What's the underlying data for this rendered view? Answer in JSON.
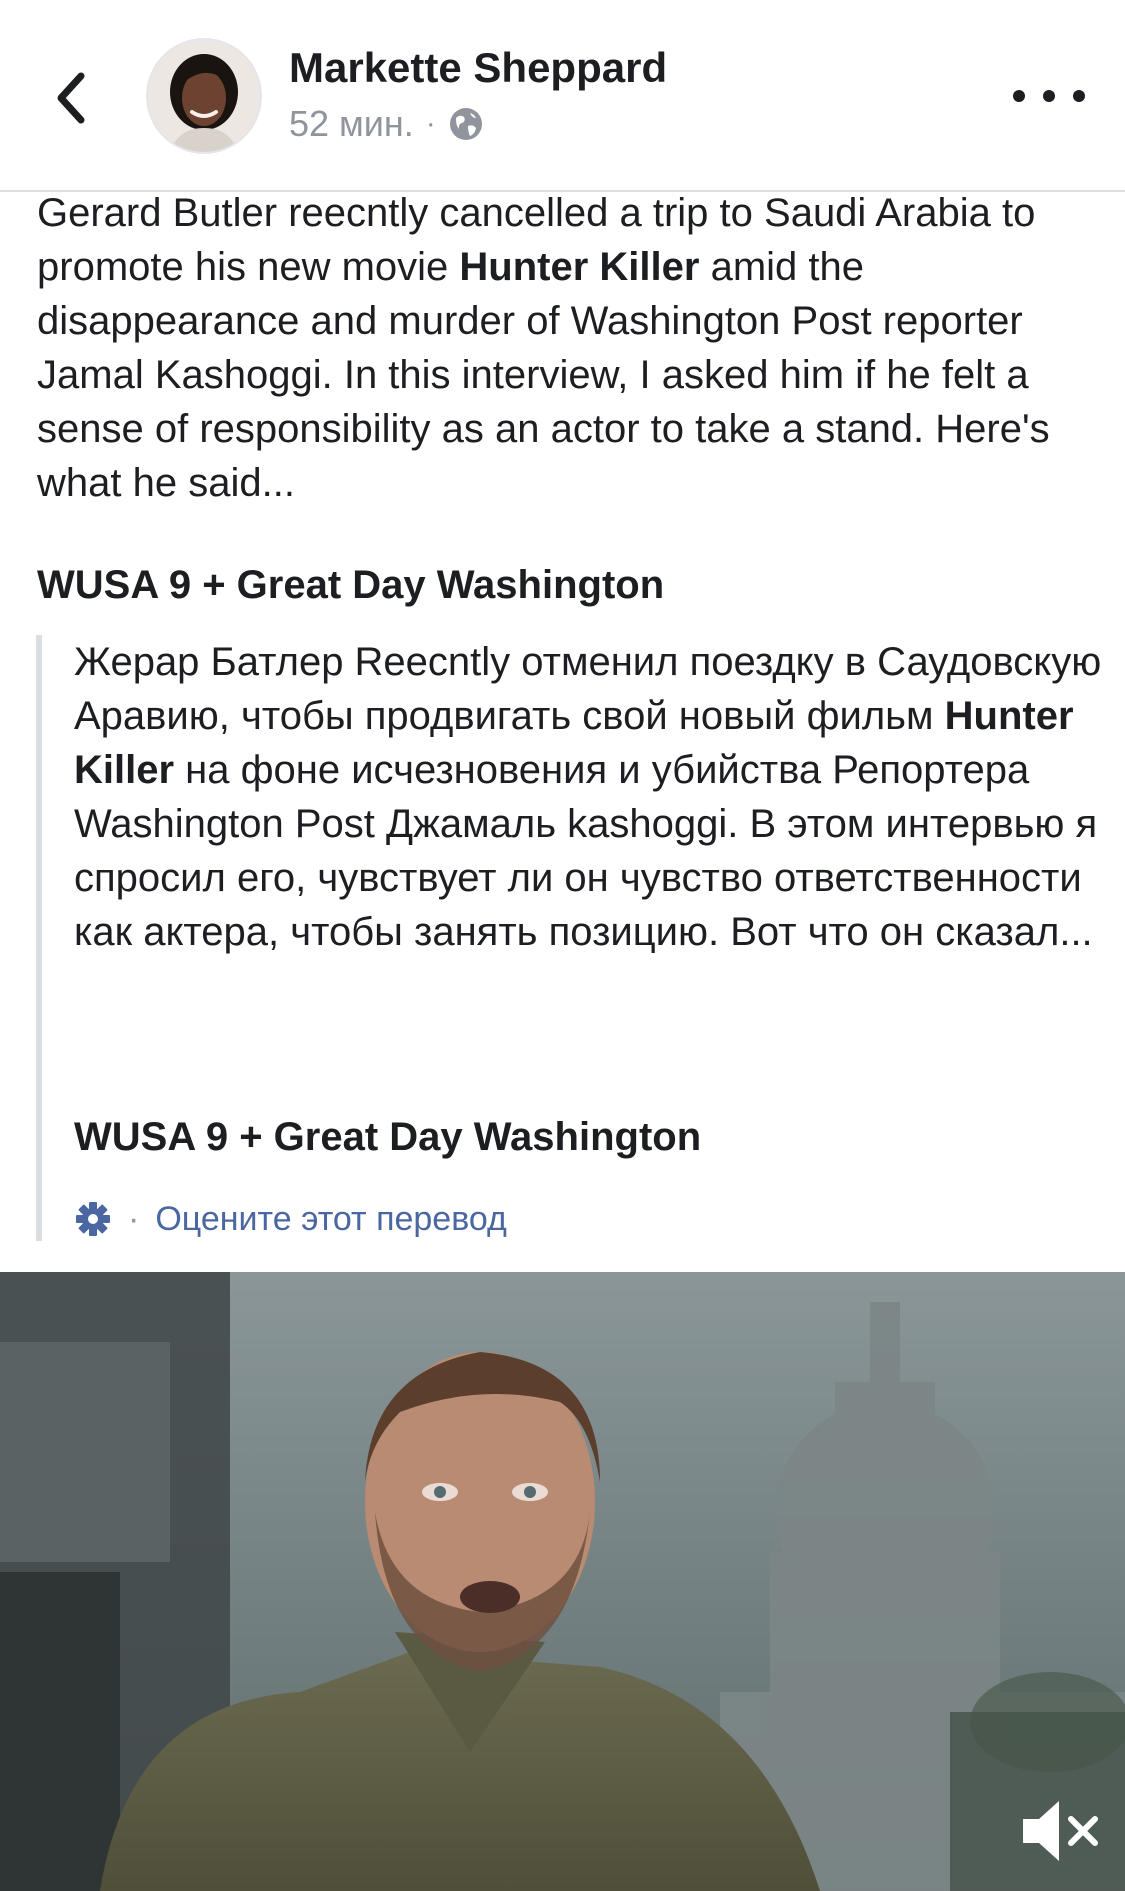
{
  "header": {
    "author_name": "Markette Sheppard",
    "time": "52 мин.",
    "separator": "·",
    "back_icon": "chevron-left-icon",
    "privacy_icon": "globe-icon",
    "more_icon": "more-horizontal-icon"
  },
  "post": {
    "text_part1": "Gerard Butler reecntly cancelled a trip to Saudi Arabia to promote his new movie ",
    "movie_title": "Hunter Killer",
    "text_part2": " amid the disappearance and murder of Washington Post reporter Jamal Kashoggi. In this interview, I asked him if he felt a sense of responsibility as an actor to take a stand. Here's what he said...",
    "source": "WUSA 9 + Great Day Washington"
  },
  "translation": {
    "text_part1": "Жерар Батлер Reecntly отменил поездку в Саудовскую Аравию, чтобы продвигать свой новый фильм ",
    "movie_title": "Hunter Killer",
    "text_part2": " на фоне исчезновения и убийства Репортера Washington Post Джамаль kashoggi. В этом интервью я спросил его, чувствует ли он чувство ответственности как актера, чтобы занять позицию. Вот что он сказал...",
    "source": "WUSA 9 + Great Day Washington",
    "gear_icon": "gear-icon",
    "separator": "·",
    "rate_label": "Оцените этот перевод",
    "link_color": "#4b67a1"
  },
  "video": {
    "mute_icon": "speaker-muted-icon"
  }
}
